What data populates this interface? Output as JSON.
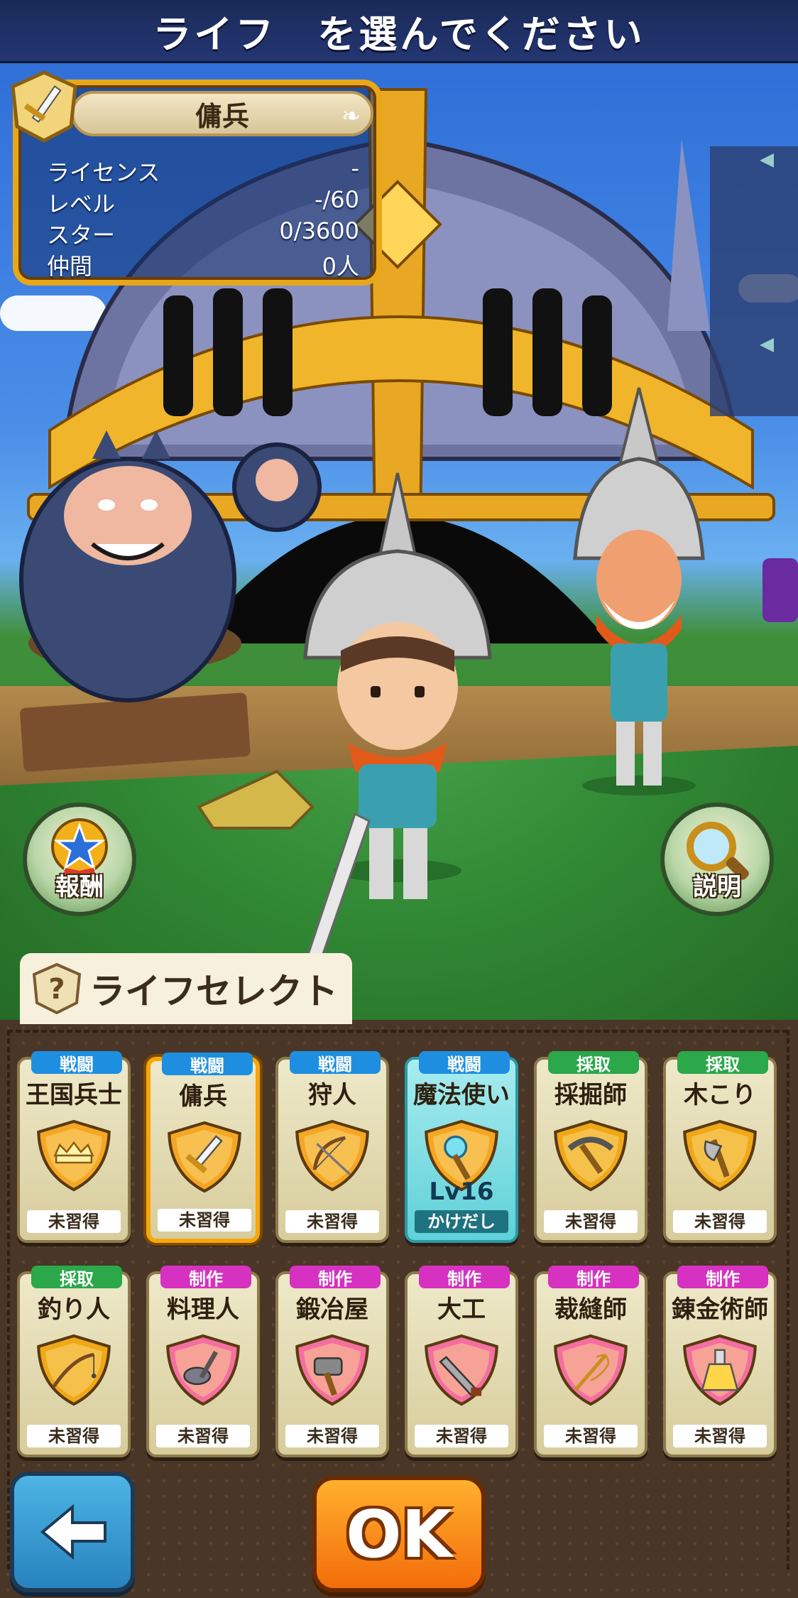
{
  "header": {
    "title": "ライフ　を選んでください"
  },
  "status_panel": {
    "job_name": "傭兵",
    "rows": [
      {
        "label": "ライセンス",
        "value": "-"
      },
      {
        "label": "レベル",
        "value": "-/60"
      },
      {
        "label": "スター",
        "value": "0/3600"
      },
      {
        "label": "仲間",
        "value": "0人"
      }
    ]
  },
  "buttons": {
    "reward_label": "報酬",
    "info_label": "説明",
    "ok_label": "OK"
  },
  "life_select": {
    "tab_label": "ライフセレクト",
    "cards": [
      {
        "category": "戦闘",
        "name": "王国兵士",
        "status": "未習得",
        "icon": "crown-shield-icon"
      },
      {
        "category": "戦闘",
        "name": "傭兵",
        "status": "未習得",
        "icon": "sword-icon"
      },
      {
        "category": "戦闘",
        "name": "狩人",
        "status": "未習得",
        "icon": "bow-arrow-icon"
      },
      {
        "category": "戦闘",
        "name": "魔法使い",
        "status": "かけだし",
        "level": "Lv16",
        "icon": "magic-wand-icon"
      },
      {
        "category": "採取",
        "name": "採掘師",
        "status": "未習得",
        "icon": "pickaxe-icon"
      },
      {
        "category": "採取",
        "name": "木こり",
        "status": "未習得",
        "icon": "axe-icon"
      },
      {
        "category": "採取",
        "name": "釣り人",
        "status": "未習得",
        "icon": "fishing-rod-icon"
      },
      {
        "category": "制作",
        "name": "料理人",
        "status": "未習得",
        "icon": "ladle-icon"
      },
      {
        "category": "制作",
        "name": "鍛冶屋",
        "status": "未習得",
        "icon": "hammer-icon"
      },
      {
        "category": "制作",
        "name": "大工",
        "status": "未習得",
        "icon": "saw-icon"
      },
      {
        "category": "制作",
        "name": "裁縫師",
        "status": "未習得",
        "icon": "needle-icon"
      },
      {
        "category": "制作",
        "name": "錬金術師",
        "status": "未習得",
        "icon": "flask-icon"
      }
    ]
  },
  "colors": {
    "combat_tag": "#1e8fe0",
    "gather_tag": "#2aa84a",
    "craft_tag": "#d631c0",
    "selected_border": "#f7a60c",
    "ok_button": "#f47a10",
    "back_button": "#3a9fd8"
  }
}
